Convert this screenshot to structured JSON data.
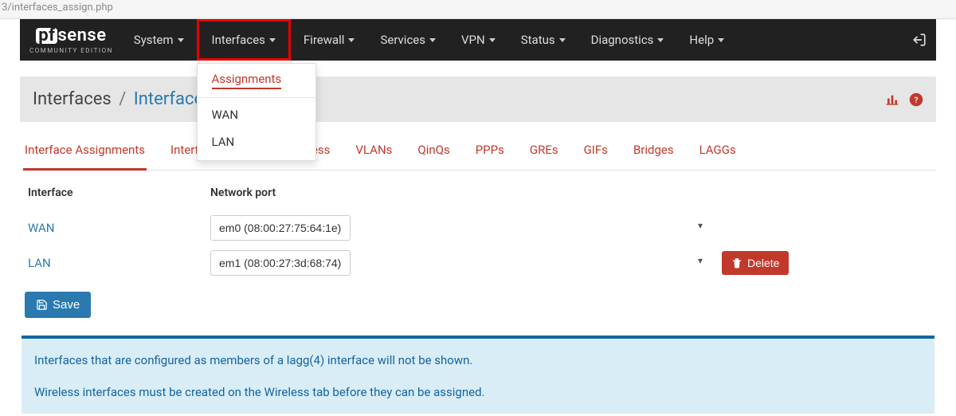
{
  "url_fragment": "3/interfaces_assign.php",
  "logo": {
    "pf": "pf",
    "sense": "sense",
    "sub": "COMMUNITY EDITION"
  },
  "nav": {
    "system": "System",
    "interfaces": "Interfaces",
    "firewall": "Firewall",
    "services": "Services",
    "vpn": "VPN",
    "status": "Status",
    "diagnostics": "Diagnostics",
    "help": "Help"
  },
  "dropdown": {
    "assignments": "Assignments",
    "wan": "WAN",
    "lan": "LAN"
  },
  "breadcrumb": {
    "root": "Interfaces",
    "current": "Interface Assignments"
  },
  "tabs": {
    "assignments": "Interface Assignments",
    "groups": "Interface Groups",
    "wireless": "Wireless",
    "vlans": "VLANs",
    "qinqs": "QinQs",
    "ppps": "PPPs",
    "gres": "GREs",
    "gifs": "GIFs",
    "bridges": "Bridges",
    "laggs": "LAGGs"
  },
  "table": {
    "head_interface": "Interface",
    "head_port": "Network port",
    "rows": [
      {
        "iface": "WAN",
        "port": "em0 (08:00:27:75:64:1e)"
      },
      {
        "iface": "LAN",
        "port": "em1 (08:00:27:3d:68:74)"
      }
    ]
  },
  "buttons": {
    "save": "Save",
    "delete": "Delete"
  },
  "info": {
    "line1": "Interfaces that are configured as members of a lagg(4) interface will not be shown.",
    "line2": "Wireless interfaces must be created on the Wireless tab before they can be assigned."
  }
}
